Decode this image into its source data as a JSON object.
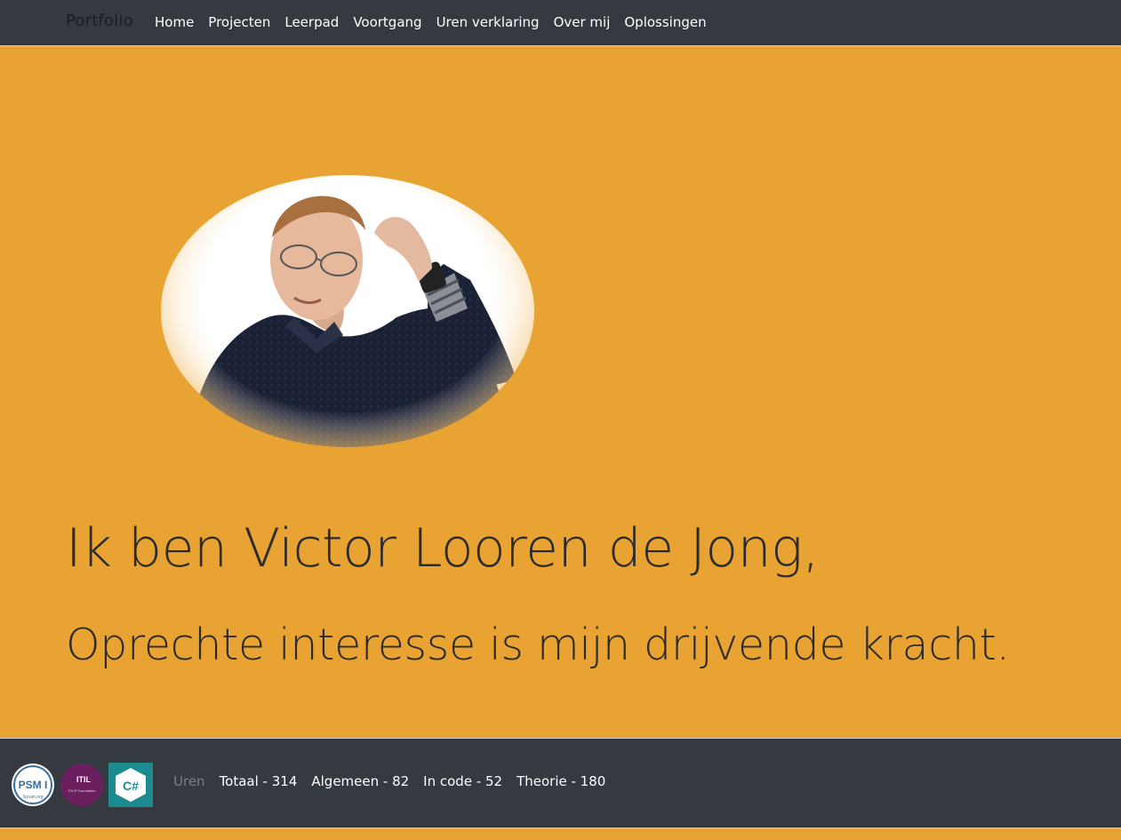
{
  "navbar": {
    "brand": "Portfolio",
    "links": [
      {
        "label": "Home"
      },
      {
        "label": "Projecten"
      },
      {
        "label": "Leerpad"
      },
      {
        "label": "Voortgang"
      },
      {
        "label": "Uren verklaring"
      },
      {
        "label": "Over mij"
      },
      {
        "label": "Oplossingen"
      }
    ]
  },
  "hero": {
    "headline": "Ik ben Victor Looren de Jong,",
    "subline": "Oprechte interesse is mijn drijvende kracht."
  },
  "footer": {
    "badges": {
      "psm": {
        "text": "PSM I",
        "subtext": "Scrum.org"
      },
      "itil": {
        "text": "ITIL",
        "subtext": "ITIL® Foundation"
      },
      "csharp": {
        "text": "C#"
      }
    },
    "hours": {
      "label": "Uren",
      "items": [
        {
          "text": "Totaal - 314"
        },
        {
          "text": "Algemeen - 82"
        },
        {
          "text": "In code - 52"
        },
        {
          "text": "Theorie - 180"
        }
      ]
    }
  },
  "colors": {
    "accent": "#E9A332",
    "dark": "#343A40",
    "text": "#2b2b2b"
  }
}
